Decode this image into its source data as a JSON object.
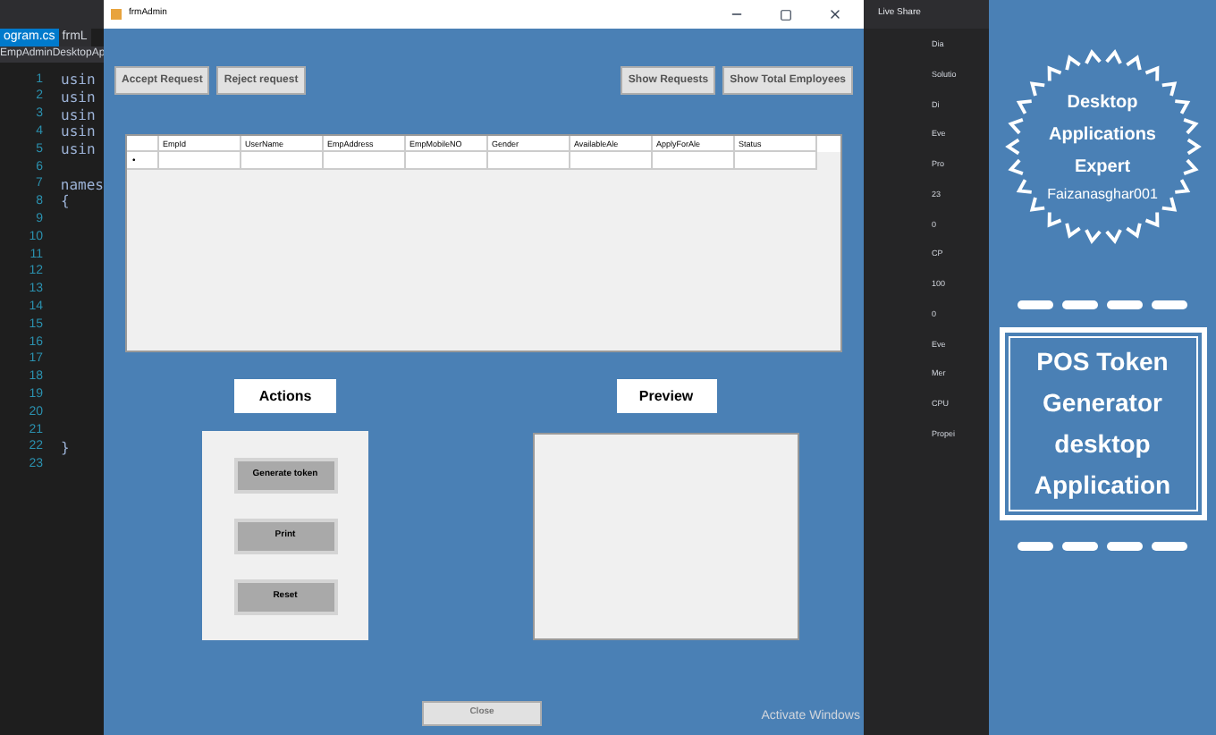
{
  "ide": {
    "tabs": [
      {
        "label": "ogram.cs",
        "selected": true
      },
      {
        "label": "frmL",
        "selected": false
      }
    ],
    "breadcrumb": "EmpAdminDesktopAp",
    "lines": [
      {
        "number": "1",
        "code": "usin"
      },
      {
        "number": "2",
        "code": "usin"
      },
      {
        "number": "3",
        "code": "usin"
      },
      {
        "number": "4",
        "code": "usin"
      },
      {
        "number": "5",
        "code": "usin"
      },
      {
        "number": "6"
      },
      {
        "number": "7",
        "code": "names"
      },
      {
        "number": "8",
        "code": "{"
      },
      {
        "number": "9"
      },
      {
        "number": "10"
      },
      {
        "number": "11"
      },
      {
        "number": "12"
      },
      {
        "number": "13"
      },
      {
        "number": "14"
      },
      {
        "number": "15"
      },
      {
        "number": "16"
      },
      {
        "number": "17"
      },
      {
        "number": "18"
      },
      {
        "number": "19"
      },
      {
        "number": "20"
      },
      {
        "number": "21"
      },
      {
        "number": "22",
        "code": "}"
      },
      {
        "number": "23"
      }
    ],
    "side_panel": {
      "live_share": "Live Share",
      "labels": [
        "Dia",
        "Solutio",
        "Di",
        "Eve",
        "Pro",
        "23",
        "0",
        "CP",
        "100",
        "0",
        "Eve",
        "Mer",
        "CPU",
        "Propei"
      ]
    },
    "activate": "Activate Windows"
  },
  "window": {
    "title": "frmAdmin",
    "left_buttons": [
      "Accept Request",
      "Reject request"
    ],
    "right_buttons": [
      "Show Requests",
      "Show Total Employees"
    ],
    "table": {
      "columns": [
        "EmpId",
        "UserName",
        "EmpAddress",
        "EmpMobileNO",
        "Gender",
        "AvailableAle",
        "ApplyForAle",
        "Status"
      ],
      "new_row_marker": "•"
    },
    "actions": {
      "label": "Actions",
      "buttons": [
        "Generate token",
        "Print",
        "Reset"
      ]
    },
    "preview": {
      "label": "Preview"
    },
    "close": "Close"
  },
  "banner": {
    "badge": [
      "Desktop",
      "Applications",
      "Expert"
    ],
    "handle": "Faizanasghar001",
    "title": [
      "POS Token",
      "Generator",
      "desktop",
      "Application"
    ]
  }
}
